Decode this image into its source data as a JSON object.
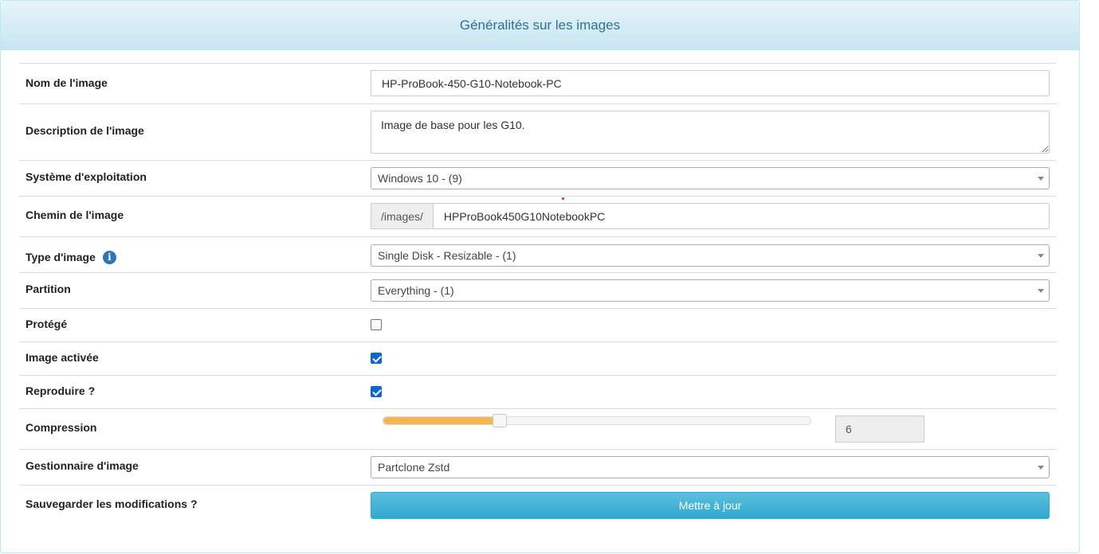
{
  "panel": {
    "title": "Généralités sur les images"
  },
  "fields": {
    "name": {
      "label": "Nom de l'image",
      "value": "HP-ProBook-450-G10-Notebook-PC"
    },
    "description": {
      "label": "Description de l'image",
      "value": "Image de base pour les G10."
    },
    "os": {
      "label": "Système d'exploitation",
      "selected": "Windows 10 - (9)"
    },
    "path": {
      "label": "Chemin de l'image",
      "prefix": "/images/",
      "value": "HPProBook450G10NotebookPC"
    },
    "type": {
      "label": "Type d'image",
      "selected": "Single Disk - Resizable - (1)",
      "info_icon": "info-circle-icon"
    },
    "partition": {
      "label": "Partition",
      "selected": "Everything - (1)"
    },
    "protected": {
      "label": "Protégé",
      "checked": false
    },
    "enabled": {
      "label": "Image activée",
      "checked": true
    },
    "replicate": {
      "label": "Reproduire ?",
      "checked": true
    },
    "compression": {
      "label": "Compression",
      "value": "6",
      "level": 6,
      "min": 0,
      "max": 22
    },
    "manager": {
      "label": "Gestionnaire d'image",
      "selected": "Partclone Zstd"
    },
    "save": {
      "label": "Sauvegarder les modifications ?",
      "button": "Mettre à jour"
    }
  },
  "colors": {
    "heading_text": "#31708f",
    "slider_fill": "#f6b64f",
    "button": "#5bc0de",
    "checkbox_checked": "#0b66d6"
  }
}
